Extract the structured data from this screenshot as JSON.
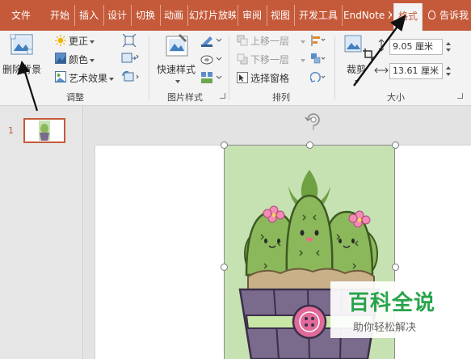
{
  "tabs": [
    {
      "label": "文件"
    },
    {
      "label": "开始"
    },
    {
      "label": "插入"
    },
    {
      "label": "设计"
    },
    {
      "label": "切换"
    },
    {
      "label": "动画"
    },
    {
      "label": "幻灯片放映"
    },
    {
      "label": "审阅"
    },
    {
      "label": "视图"
    },
    {
      "label": "开发工具"
    },
    {
      "label": "EndNote X"
    },
    {
      "label": "格式"
    }
  ],
  "tell_me": "告诉我",
  "ribbon": {
    "remove_background": "删除背景",
    "corrections": "更正",
    "color": "颜色",
    "artistic_effects": "艺术效果",
    "group_adjust": "调整",
    "quick_styles": "快速样式",
    "group_picture_styles": "图片样式",
    "bring_forward": "上移一层",
    "send_backward": "下移一层",
    "selection_pane": "选择窗格",
    "group_arrange": "排列",
    "crop": "裁剪",
    "height_value": "9.05 厘米",
    "width_value": "13.61 厘米",
    "group_size": "大小"
  },
  "slides": {
    "slide_number": "1"
  },
  "watermark": {
    "title": "百科全说",
    "subtitle": "助你轻松解决"
  },
  "colors": {
    "accent": "#c55a3a",
    "picture_background": "#c7e2b2",
    "cactus": "#8cb85c",
    "pot": "#7a6a8c",
    "watermark_green": "#27a44a"
  }
}
